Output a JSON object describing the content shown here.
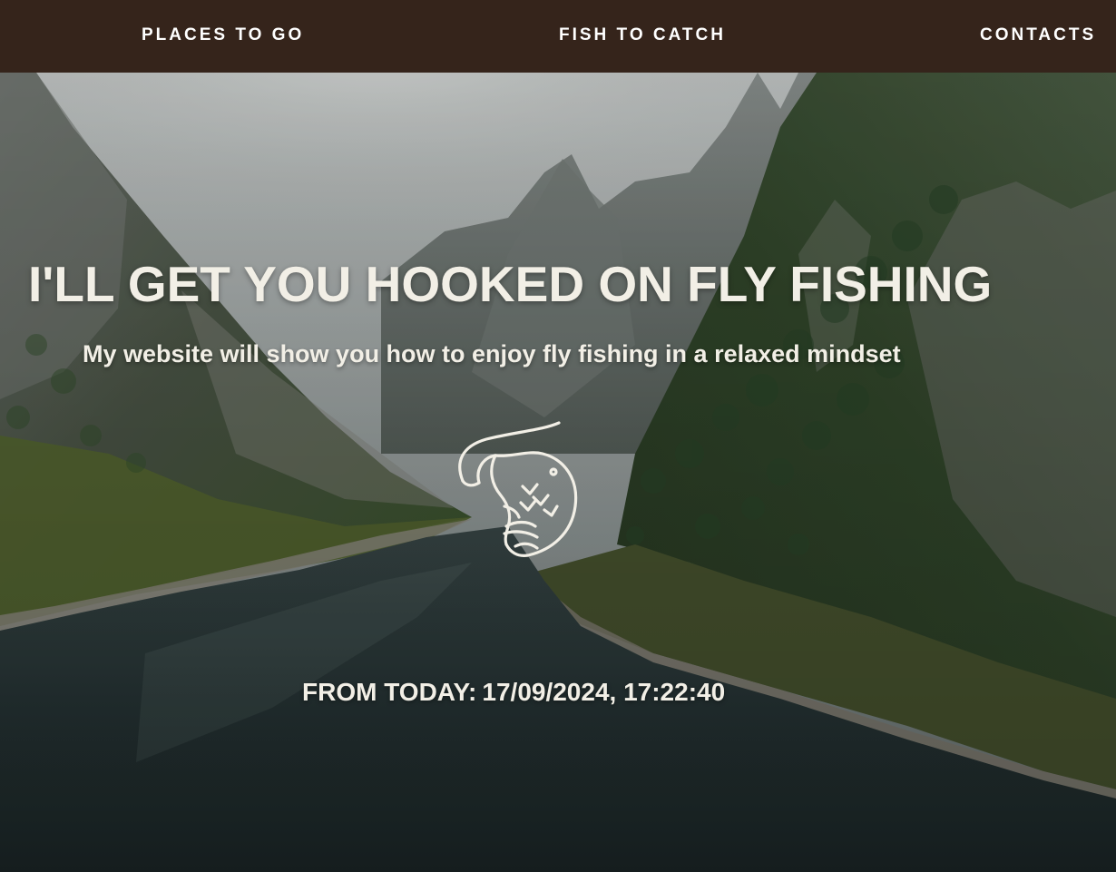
{
  "nav": {
    "items": [
      {
        "label": "PLACES TO GO"
      },
      {
        "label": "FISH TO CATCH"
      },
      {
        "label": "CONTACTS"
      }
    ],
    "background": "#35241b"
  },
  "hero": {
    "headline": "I'LL GET YOU HOOKED ON FLY FISHING",
    "subheadline": "My website will show you how to enjoy fly fishing in a relaxed mindset",
    "logo_icon": "fish-icon",
    "clock": {
      "label": "FROM TODAY:",
      "value": "17/09/2024, 17:22:40"
    },
    "background_image": "mountain-lake-landscape",
    "text_color": "#f2efe6"
  }
}
